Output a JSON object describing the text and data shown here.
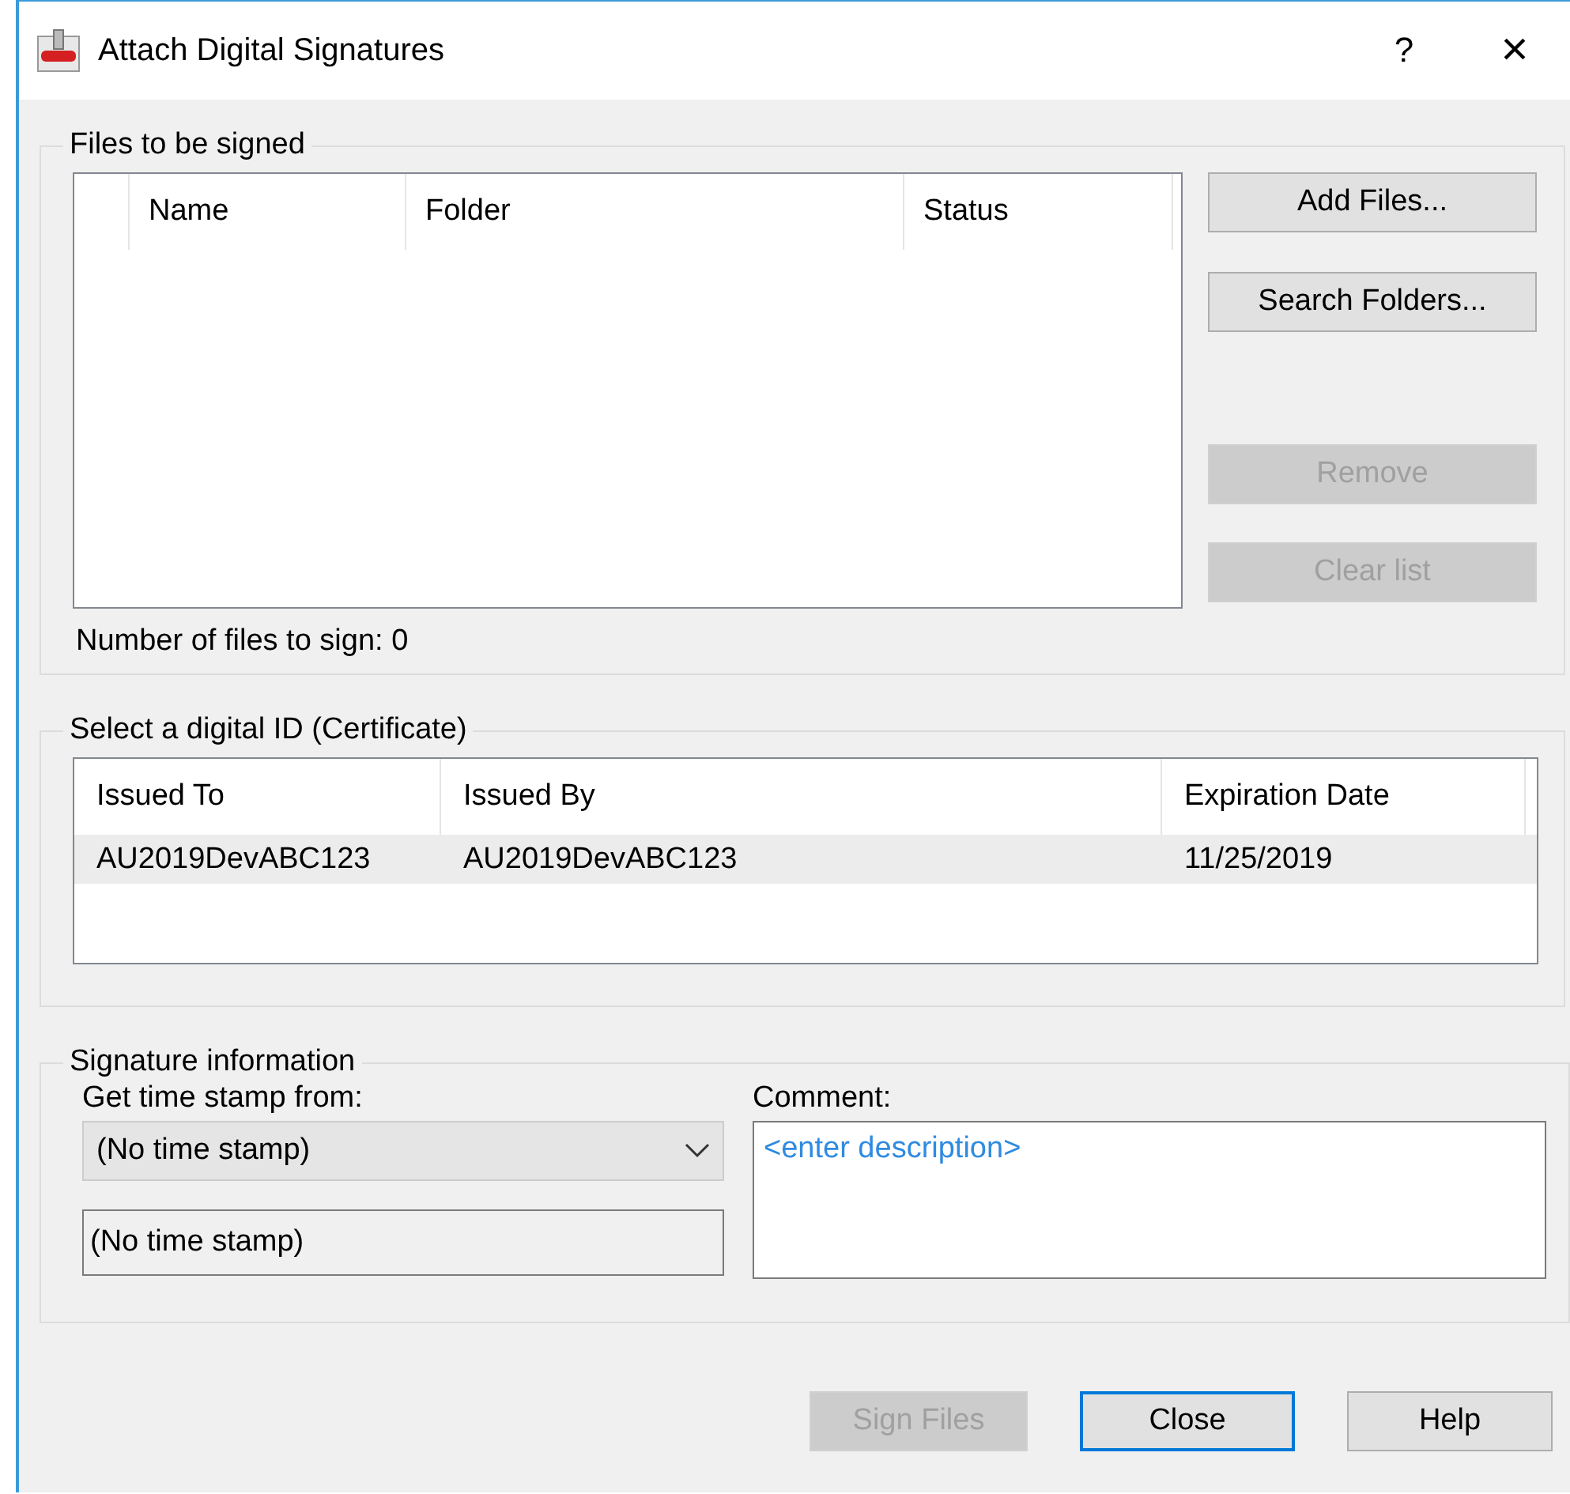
{
  "window": {
    "title": "Attach Digital Signatures",
    "help": "?",
    "close": "×"
  },
  "files_group": {
    "title": "Files to be signed",
    "columns": [
      "Name",
      "Folder",
      "Status"
    ],
    "buttons": [
      {
        "label": "Add Files...",
        "disabled": false
      },
      {
        "label": "Search Folders...",
        "disabled": false
      },
      {
        "label": "Remove",
        "disabled": true
      },
      {
        "label": "Clear list",
        "disabled": true
      }
    ],
    "count": "Number of files to sign: 0"
  },
  "certificate_group": {
    "title": "Select a digital ID (Certificate)",
    "columns": [
      "Issued To",
      "Issued By",
      "Expiration Date"
    ],
    "rows": [
      {
        "cells": [
          "AU2019DevABC123",
          "AU2019DevABC123",
          "11/25/2019"
        ],
        "selected": true
      }
    ]
  },
  "signature_group": {
    "title": "Signature information",
    "timestamp_label": "Get time stamp from:",
    "timestamp_value": "(No time stamp)",
    "timestamp_field": "(No time stamp)",
    "comment_label": "Comment:",
    "comment_placeholder": "<enter description>"
  },
  "buttons": [
    {
      "label": "Sign Files",
      "disabled": true,
      "default": false
    },
    {
      "label": "Close",
      "disabled": false,
      "default": true
    },
    {
      "label": "Help",
      "disabled": false,
      "default": false
    }
  ]
}
